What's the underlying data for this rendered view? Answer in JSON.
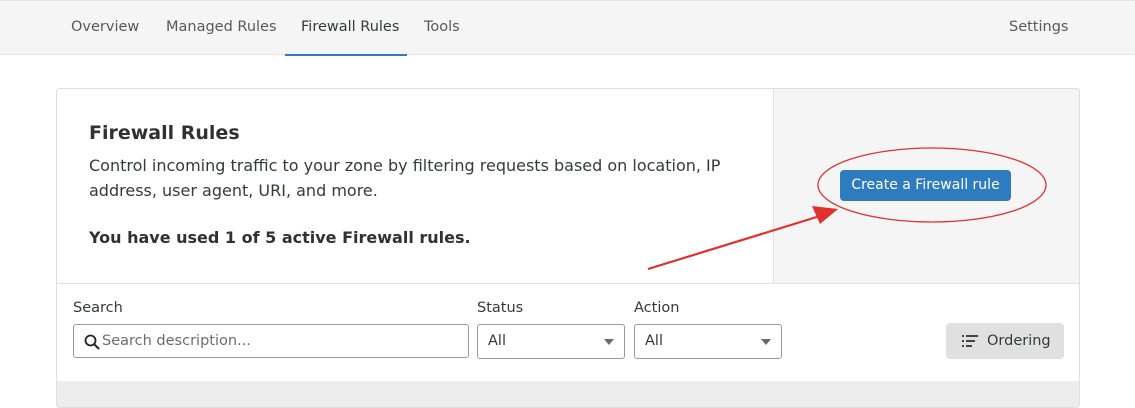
{
  "tabs": [
    {
      "label": "Overview"
    },
    {
      "label": "Managed Rules"
    },
    {
      "label": "Firewall Rules",
      "active": true
    },
    {
      "label": "Tools"
    }
  ],
  "settings_label": "Settings",
  "card": {
    "title": "Firewall Rules",
    "description": "Control incoming traffic to your zone by filtering requests based on location, IP address, user agent, URI, and more.",
    "usage": "You have used 1 of 5 active Firewall rules.",
    "create_button": "Create a Firewall rule"
  },
  "filters": {
    "search_label": "Search",
    "search_placeholder": "Search description...",
    "status_label": "Status",
    "status_value": "All",
    "action_label": "Action",
    "action_value": "All",
    "ordering_label": "Ordering"
  },
  "colors": {
    "accent": "#2f7bbf",
    "annotation": "#e03030"
  },
  "icons": [
    "search-icon",
    "ordering-icon",
    "chevron-down-icon"
  ]
}
